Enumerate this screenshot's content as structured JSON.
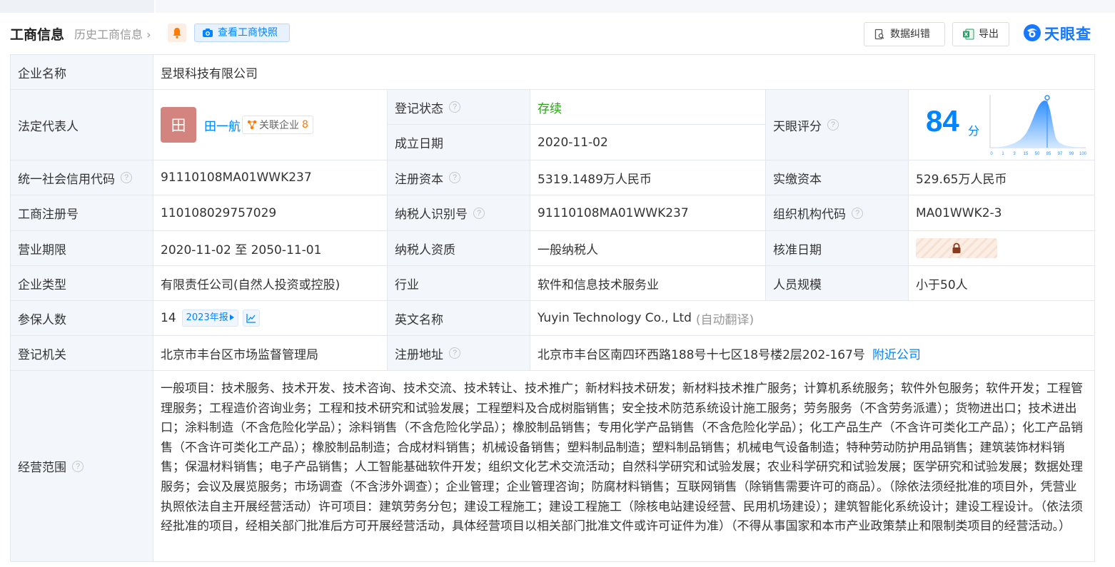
{
  "header": {
    "title": "工商信息",
    "history_link": "历史工商信息",
    "history_chevron": "›",
    "snapshot_button": "查看工商快照",
    "correct_button": "数据纠错",
    "export_button": "导出",
    "brand": "天眼查"
  },
  "fields": {
    "company_name_label": "企业名称",
    "company_name": "昱垠科技有限公司",
    "legal_rep_label": "法定代表人",
    "legal_rep_avatar": "田",
    "legal_rep_name": "田一航",
    "assoc_label": "关联企业",
    "assoc_count": "8",
    "reg_status_label": "登记状态",
    "reg_status": "存续",
    "established_label": "成立日期",
    "established": "2020-11-02",
    "score_label": "天眼评分",
    "score": "84",
    "score_unit": "分",
    "score_ticks": [
      "0",
      "1",
      "3",
      "15",
      "50",
      "85",
      "97",
      "99",
      "100"
    ],
    "credit_code_label": "统一社会信用代码",
    "credit_code": "91110108MA01WWK237",
    "reg_capital_label": "注册资本",
    "reg_capital": "5319.1489万人民币",
    "paid_capital_label": "实缴资本",
    "paid_capital": "529.65万人民币",
    "biz_reg_no_label": "工商注册号",
    "biz_reg_no": "110108029757029",
    "taxpayer_id_label": "纳税人识别号",
    "taxpayer_id": "91110108MA01WWK237",
    "org_code_label": "组织机构代码",
    "org_code": "MA01WWK2-3",
    "biz_term_label": "营业期限",
    "biz_term": "2020-11-02 至 2050-11-01",
    "taxpayer_qual_label": "纳税人资质",
    "taxpayer_qual": "一般纳税人",
    "approval_date_label": "核准日期",
    "company_type_label": "企业类型",
    "company_type": "有限责任公司(自然人投资或控股)",
    "industry_label": "行业",
    "industry": "软件和信息技术服务业",
    "staff_size_label": "人员规模",
    "staff_size": "小于50人",
    "insured_label": "参保人数",
    "insured_count": "14",
    "insured_year": "2023年报",
    "english_name_label": "英文名称",
    "english_name": "Yuyin Technology Co., Ltd",
    "english_name_note": "(自动翻译)",
    "reg_authority_label": "登记机关",
    "reg_authority": "北京市丰台区市场监督管理局",
    "reg_address_label": "注册地址",
    "reg_address": "北京市丰台区南四环西路188号十七区18号楼2层202-167号",
    "nearby_link": "附近公司",
    "scope_label": "经营范围",
    "scope": "一般项目：技术服务、技术开发、技术咨询、技术交流、技术转让、技术推广；新材料技术研发；新材料技术推广服务；计算机系统服务；软件外包服务；软件开发；工程管理服务；工程造价咨询业务；工程和技术研究和试验发展；工程塑料及合成树脂销售；安全技术防范系统设计施工服务；劳务服务（不含劳务派遣）；货物进出口；技术进出口；涂料制造（不含危险化学品）；涂料销售（不含危险化学品）；橡胶制品销售；专用化学产品销售（不含危险化学品）；化工产品生产（不含许可类化工产品）；化工产品销售（不含许可类化工产品）；橡胶制品制造；合成材料销售；机械设备销售；塑料制品制造；塑料制品销售；机械电气设备制造；特种劳动防护用品销售；建筑装饰材料销售；保温材料销售；电子产品销售；人工智能基础软件开发；组织文化艺术交流活动；自然科学研究和试验发展；农业科学研究和试验发展；医学研究和试验发展；数据处理服务；会议及展览服务；市场调查（不含涉外调查）；企业管理；企业管理咨询；防腐材料销售；互联网销售（除销售需要许可的商品）。（除依法须经批准的项目外，凭营业执照依法自主开展经营活动）许可项目：建筑劳务分包；建设工程施工；建设工程施工（除核电站建设经营、民用机场建设）；建筑智能化系统设计；建设工程设计。（依法须经批准的项目，经相关部门批准后方可开展经营活动，具体经营项目以相关部门批准文件或许可证件为准）（不得从事国家和本市产业政策禁止和限制类项目的经营活动。）"
  },
  "help_icon": "?",
  "icons": [
    "bell-icon",
    "camera-icon",
    "correct-icon",
    "excel-icon",
    "brand-logo-icon",
    "network-icon",
    "play-icon",
    "trend-icon",
    "lock-icon"
  ],
  "colors": {
    "accent": "#0084ff",
    "status_green": "#2aa515",
    "label_bg": "#f3f7fc",
    "avatar_bg": "#d3847f",
    "count_orange": "#ff7a00"
  }
}
